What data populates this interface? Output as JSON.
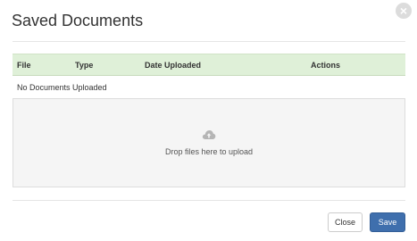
{
  "dialog": {
    "title": "Saved Documents",
    "close_icon_glyph": "×"
  },
  "table": {
    "columns": [
      "File",
      "Type",
      "Date Uploaded",
      "Actions"
    ],
    "empty_message": "No Documents Uploaded"
  },
  "dropzone": {
    "icon": "cloud-upload-icon",
    "label": "Drop files here to upload"
  },
  "footer": {
    "close_label": "Close",
    "save_label": "Save"
  },
  "colors": {
    "table_header_bg": "#dff0d8",
    "primary_button": "#3f6fad",
    "dropzone_bg": "#f5f5f5"
  }
}
